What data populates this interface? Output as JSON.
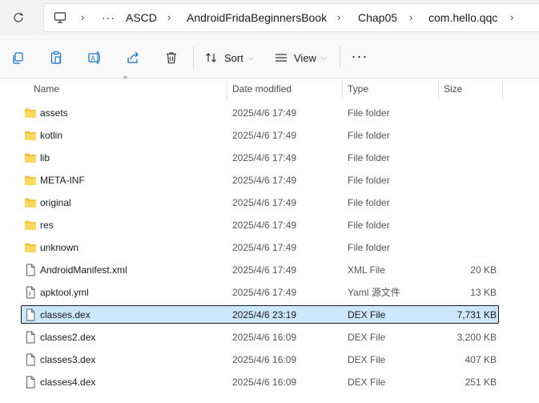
{
  "breadcrumb": {
    "items": [
      "ASCD",
      "AndroidFridaBeginnersBook",
      "Chap05",
      "com.hello.qqc"
    ],
    "overflow_label": "···",
    "separator": "›"
  },
  "toolbar": {
    "sort_label": "Sort",
    "view_label": "View",
    "more_label": "···"
  },
  "columns": {
    "name": "Name",
    "date": "Date modified",
    "type": "Type",
    "size": "Size"
  },
  "files": [
    {
      "name": "assets",
      "date": "2025/4/6 17:49",
      "type": "File folder",
      "size": "",
      "icon": "folder-icon"
    },
    {
      "name": "kotlin",
      "date": "2025/4/6 17:49",
      "type": "File folder",
      "size": "",
      "icon": "folder-icon"
    },
    {
      "name": "lib",
      "date": "2025/4/6 17:49",
      "type": "File folder",
      "size": "",
      "icon": "folder-icon"
    },
    {
      "name": "META-INF",
      "date": "2025/4/6 17:49",
      "type": "File folder",
      "size": "",
      "icon": "folder-icon"
    },
    {
      "name": "original",
      "date": "2025/4/6 17:49",
      "type": "File folder",
      "size": "",
      "icon": "folder-icon"
    },
    {
      "name": "res",
      "date": "2025/4/6 17:49",
      "type": "File folder",
      "size": "",
      "icon": "folder-icon"
    },
    {
      "name": "unknown",
      "date": "2025/4/6 17:49",
      "type": "File folder",
      "size": "",
      "icon": "folder-icon"
    },
    {
      "name": "AndroidManifest.xml",
      "date": "2025/4/6 17:49",
      "type": "XML File",
      "size": "20 KB",
      "icon": "file-icon"
    },
    {
      "name": "apktool.yml",
      "date": "2025/4/6 17:49",
      "type": "Yaml 源文件",
      "size": "13 KB",
      "icon": "yaml-file-icon"
    },
    {
      "name": "classes.dex",
      "date": "2025/4/6 23:19",
      "type": "DEX File",
      "size": "7,731 KB",
      "icon": "file-icon",
      "selected": true
    },
    {
      "name": "classes2.dex",
      "date": "2025/4/6 16:09",
      "type": "DEX File",
      "size": "3,200 KB",
      "icon": "file-icon"
    },
    {
      "name": "classes3.dex",
      "date": "2025/4/6 16:09",
      "type": "DEX File",
      "size": "407 KB",
      "icon": "file-icon"
    },
    {
      "name": "classes4.dex",
      "date": "2025/4/6 16:09",
      "type": "DEX File",
      "size": "251 KB",
      "icon": "file-icon"
    }
  ],
  "colors": {
    "accent": "#1a73c9",
    "selection": "#cce8ff",
    "folder": "#f4c542"
  }
}
